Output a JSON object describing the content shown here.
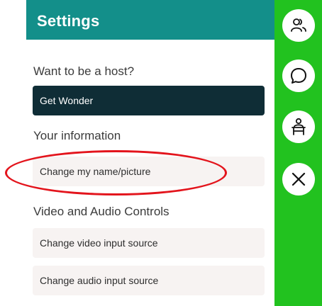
{
  "settings": {
    "title": "Settings",
    "host_section_label": "Want to be a host?",
    "get_wonder_label": "Get Wonder",
    "info_section_label": "Your information",
    "change_name_label": "Change my name/picture",
    "av_section_label": "Video and Audio Controls",
    "change_video_label": "Change video input source",
    "change_audio_label": "Change audio input source"
  },
  "rail": {
    "icons": [
      "people-icon",
      "chat-bubble-icon",
      "presenter-icon",
      "close-icon"
    ]
  },
  "colors": {
    "header": "#138f8a",
    "rail": "#22c21f",
    "dark_button": "#0f2d36",
    "light_button": "#f7f3f2",
    "annotation": "#e3141c"
  }
}
